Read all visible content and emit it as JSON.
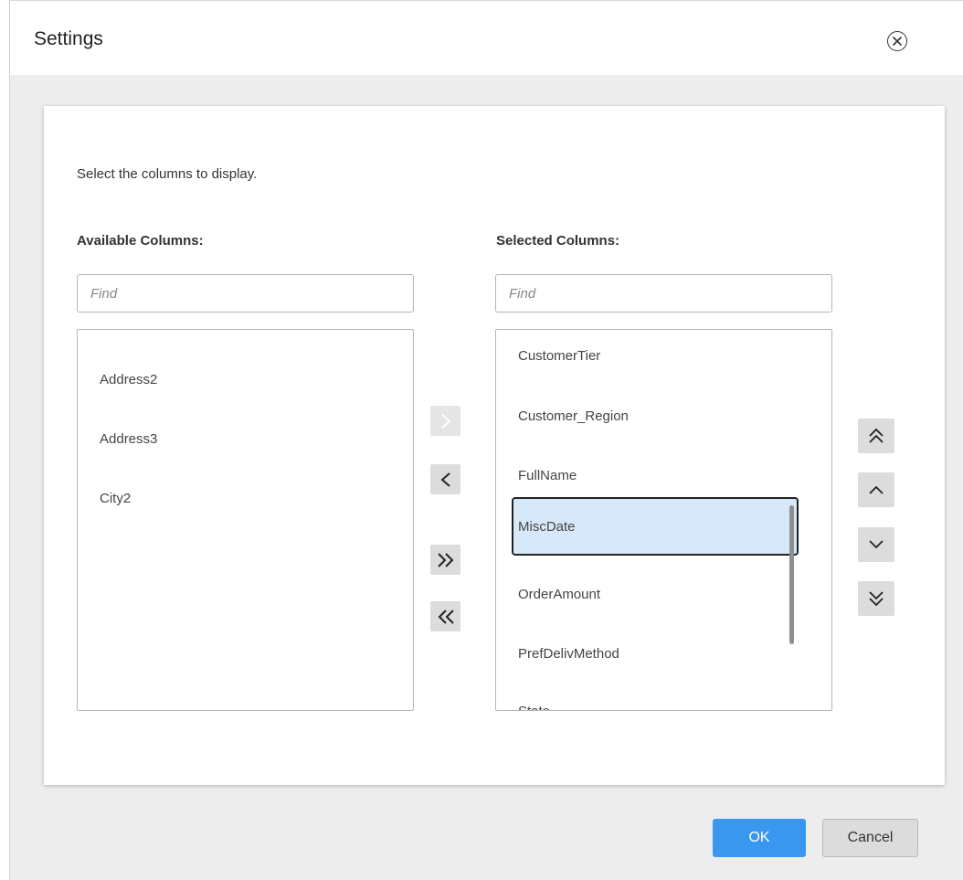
{
  "dialog": {
    "title": "Settings",
    "close_icon": "close-circle-icon"
  },
  "panel": {
    "instruction": "Select the columns to display."
  },
  "available": {
    "label": "Available Columns:",
    "find_placeholder": "Find",
    "items": [
      "Address2",
      "Address3",
      "City2"
    ]
  },
  "selected": {
    "label": "Selected Columns:",
    "find_placeholder": "Find",
    "items": [
      "CustomerTier",
      "Customer_Region",
      "FullName",
      "MiscDate",
      "OrderAmount",
      "PrefDelivMethod",
      "State"
    ],
    "selected_item": "MiscDate"
  },
  "transfer_buttons": {
    "add": "›",
    "remove": "‹",
    "add_all": "»",
    "remove_all": "«",
    "add_enabled": false
  },
  "order_buttons": {
    "move_top": "⌃",
    "move_up": "⌃",
    "move_down": "⌄",
    "move_bottom": "⌄"
  },
  "footer": {
    "ok_label": "OK",
    "cancel_label": "Cancel"
  },
  "colors": {
    "primary": "#3a97f0",
    "selection": "#d7e9f9"
  }
}
